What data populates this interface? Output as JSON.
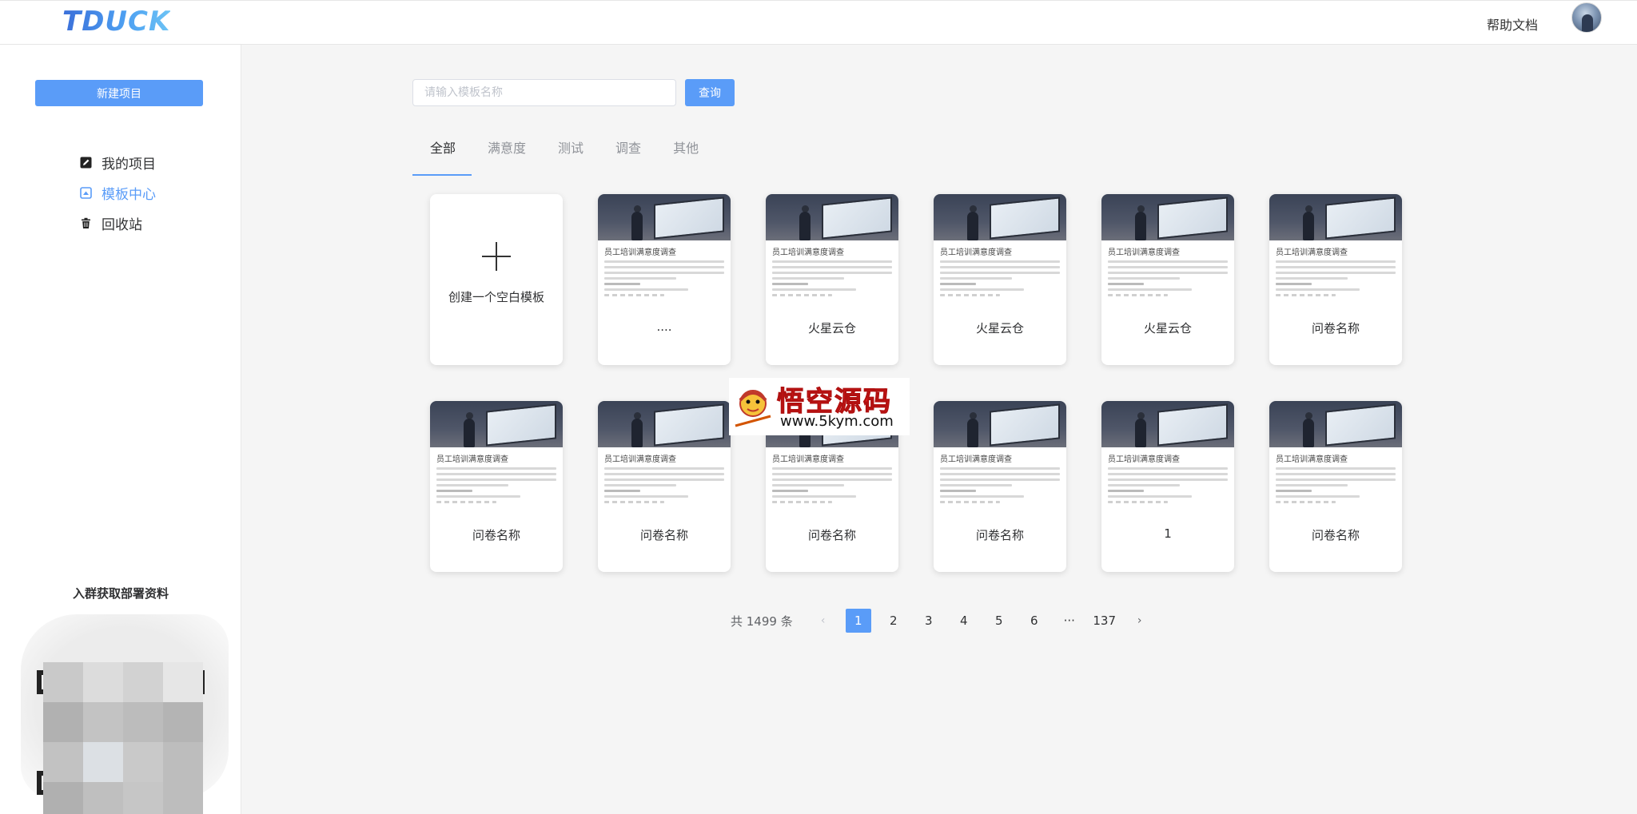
{
  "header": {
    "logo": "TDUCK",
    "help_label": "帮助文档"
  },
  "sidebar": {
    "new_project_label": "新建项目",
    "items": [
      {
        "label": "我的项目",
        "icon": "edit-icon",
        "active": false
      },
      {
        "label": "模板中心",
        "icon": "template-icon",
        "active": true
      },
      {
        "label": "回收站",
        "icon": "trash-icon",
        "active": false
      }
    ],
    "qr_title": "入群获取部署资料"
  },
  "search": {
    "placeholder": "请输入模板名称",
    "value": "",
    "button_label": "查询"
  },
  "tabs": [
    {
      "label": "全部",
      "active": true
    },
    {
      "label": "满意度",
      "active": false
    },
    {
      "label": "测试",
      "active": false
    },
    {
      "label": "调查",
      "active": false
    },
    {
      "label": "其他",
      "active": false
    }
  ],
  "blank_template_label": "创建一个空白模板",
  "card_preview_title": "员工培训满意度调查",
  "cards": [
    {
      "name": "...."
    },
    {
      "name": "火星云仓"
    },
    {
      "name": "火星云仓"
    },
    {
      "name": "火星云仓"
    },
    {
      "name": "问卷名称"
    },
    {
      "name": "问卷名称"
    },
    {
      "name": "问卷名称"
    },
    {
      "name": "问卷名称"
    },
    {
      "name": "问卷名称"
    },
    {
      "name": "1"
    },
    {
      "name": "问卷名称"
    }
  ],
  "pagination": {
    "total_text": "共 1499 条",
    "prev": "‹",
    "next": "›",
    "pages": [
      "1",
      "2",
      "3",
      "4",
      "5",
      "6",
      "···",
      "137"
    ],
    "current": "1"
  },
  "watermark": {
    "title": "悟空源码",
    "url": "www.5kym.com"
  },
  "colors": {
    "accent": "#5a9cf8",
    "background": "#f5f5f5",
    "watermark_red": "#e01d1d"
  }
}
